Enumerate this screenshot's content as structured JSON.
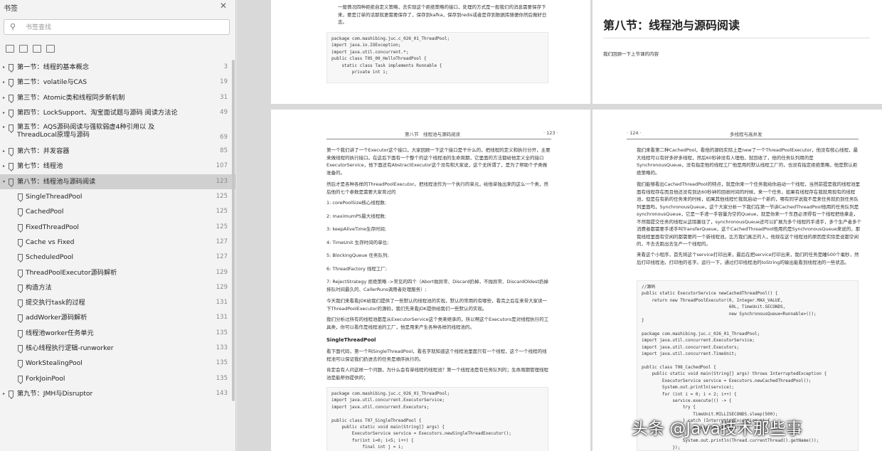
{
  "sidebar": {
    "title": "书签",
    "search_placeholder": "书签查找",
    "items": [
      {
        "label": "第一节：线程的基本概念",
        "page": "3",
        "level": 0,
        "expand": "▸"
      },
      {
        "label": "第二节：volatile与CAS",
        "page": "19",
        "level": 0,
        "expand": "▸"
      },
      {
        "label": "第三节：Atomic类和线程同步新机制",
        "page": "31",
        "level": 0,
        "expand": "▸"
      },
      {
        "label": "第四节：LockSupport、淘宝面试题与源码  阅读方法论",
        "page": "49",
        "level": 0,
        "expand": "▸"
      },
      {
        "label": "第五节：AQS源码阅读与强软弱虚4种引用以  及ThreadLocal原理与源码",
        "page": "69",
        "level": 0,
        "expand": "▸",
        "two": true
      },
      {
        "label": "第六节：并发容器",
        "page": "85",
        "level": 0,
        "expand": "▸"
      },
      {
        "label": "第七节：线程池",
        "page": "107",
        "level": 0,
        "expand": "▸"
      },
      {
        "label": "第八节：线程池与源码阅读",
        "page": "123",
        "level": 0,
        "expand": "▾",
        "selected": true
      },
      {
        "label": "SingleThreadPool",
        "page": "125",
        "level": 1,
        "expand": ""
      },
      {
        "label": "CachedPool",
        "page": "125",
        "level": 1,
        "expand": ""
      },
      {
        "label": "FixedThreadPool",
        "page": "125",
        "level": 1,
        "expand": ""
      },
      {
        "label": "Cache vs Fixed",
        "page": "127",
        "level": 1,
        "expand": ""
      },
      {
        "label": "ScheduledPool",
        "page": "127",
        "level": 1,
        "expand": ""
      },
      {
        "label": "ThreadPoolExecutor源码解析",
        "page": "129",
        "level": 1,
        "expand": ""
      },
      {
        "label": "构造方法",
        "page": "129",
        "level": 1,
        "expand": ""
      },
      {
        "label": "提交执行task的过程",
        "page": "131",
        "level": 1,
        "expand": ""
      },
      {
        "label": "addWorker源码解析",
        "page": "131",
        "level": 1,
        "expand": ""
      },
      {
        "label": "线程池worker任务单元",
        "page": "135",
        "level": 1,
        "expand": ""
      },
      {
        "label": "核心线程执行逻辑-runworker",
        "page": "133",
        "level": 1,
        "expand": ""
      },
      {
        "label": "WorkStealingPool",
        "page": "135",
        "level": 1,
        "expand": ""
      },
      {
        "label": "ForkJoinPool",
        "page": "135",
        "level": 1,
        "expand": ""
      },
      {
        "label": "第九节：JMH与Disruptor",
        "page": "143",
        "level": 0,
        "expand": "▸"
      }
    ]
  },
  "pages": {
    "p1": {
      "intro": "一般情况四种拒绝自定义策略，去实现这个拒绝策略的接口，处理的方式是一般我们的消息需要保存下来，要是订单的话那就更需要保存了，保存到kafka，保存到redis或者是存到数据库随便你然后做好日志。",
      "code": [
        "package com.mashibing.juc.c_026_01_ThreadPool;",
        "import java.io.IOException;",
        "import java.util.concurrent.*;",
        "public class T05_00_HelloThreadPool {",
        "    static class Task implements Runnable {",
        "        private int i;"
      ]
    },
    "p2": {
      "title": "第八节：线程池与源码阅读",
      "intro": "我们回顾一下上节课的内容"
    },
    "p3": {
      "header_title": "第八节　线程池与源码阅读",
      "header_page": "· 123 ·",
      "para1": "第一个我们讲了一个Executor这个接口，大家回顾一下这个接口是干什么的，把线程的定义和执行分开，主要来做线程的执行接口。在这后下面有一个整个的这个线程池的生命周期，它里面的方法都给他定义全的接口ExecutorService，他下面还有AbstractExecutor这个没有和大家说，这个无所谓了，是为了帮助个子类做准备的。",
      "para2": "然后才是各种各样的ThreadPoolExecutor。把线程池作为一个执行的单元，给他单独出来的这么一个类，然后他的七个参数是需要大家背过的",
      "params": [
        "1:  corePoolSize核心线程数;",
        "2:  maximumPS最大线程数;",
        "3:  keepAliveTime生存时间;",
        "4:  TimeUnit 生存时间的单位;",
        "5:  BlockingQueue 任务队列;",
        "6:  ThreadFactory 线程工厂;",
        "7:  RejectStrategy 拒绝策略 ->常见的四个（Abort抛异常、Discard扔掉，不抛异常、DiscardOldest扔掉排队时间最久的、CallerRuns调用者处理服务）;"
      ],
      "para3": "今天我们来看看JDK给我们提供了一些默认的线程池的实现，默认的常用的有哪些，看完之后在来带大家读一下ThreadPoolExecutor的源码，我们先来看JDK提供给我们一些默认的实现。",
      "para4": "我们分析过所有的线程池都是从ExecutorService这个类来继承的，所以啊这个Executors是对线程执行的工具类，你可以看作是线程池的工厂，他是用来产生各种各样的线程池的。",
      "sec": "SingleThreadPool",
      "para5": "看下面代码，第一个叫SingleThreadPool，看名字就知道这个线程池里面只有一个线程，这个一个线程的线程池可以保证我们扔进去的任务是顺序执行的。",
      "para6": "肯定会有人问这样一个问题，为什么会有单线程的线程池？第一个线程池是有任务队列的；生命周期管理线程池是能帮你提供的；",
      "code": [
        "package com.mashibing.juc.c_026_01_ThreadPool;",
        "import java.util.concurrent.ExecutorService;",
        "import java.util.concurrent.Executors;",
        "",
        "public class T07_SingleThreadPool {",
        "    public static void main(String[] args) {",
        "        ExecutorService service = Executors.newSingleThreadExecutor();",
        "        for(int i=0; i<5; i++) {",
        "            final int j = i;"
      ]
    },
    "p4": {
      "header_page": "· 124 ·",
      "header_title": "多线程与高并发",
      "para1": "我们来看第二种CachedPool，看他的源码实际上是new了一个ThreadPoolExecutor，他没有核心线程，最大线程可以有好多好多线程，然后60秒钟没有人理他，就回收了，他的任务队列用的是SynchronousQueue，没有指定他的线程工厂他是用的默认线程工厂的，也没有指定拒绝策略，他是默认拒绝策略的。",
      "para2": "我们能够看出CachedThreadPool的特点，就是你来一个任务我给你启动一个线程，当然前提是我的线程池里面有线程存在而且他还没有到达60秒钟的回收时间的时候，来一个任务，如果有线程存在我就用现有的线程池，但是在有新的任务来的时候，如果其他线程忙我就启动一个新的，哪有同学说我不是来任务就扔到任务队列里面吗，SynchronousQueue，这个大家分析一下我们在第一节讲CachedThreadPool他用的任务队列是synchronousQueue，它是一手递一手容量为空的Queue，就是你来一个东西必须得有一个线程把他拿走，不然我提交任务的线程从这阻塞住了，synchronousQueue还可以扩展为多个线程的手递手，多个生产者多个消费者都需要手递手叫TransferQueue，这个CachedThreadPool他用的是SynchronousQueue来说的，那我线程里面有空闲的都需要的一个新线程池，比方我们真正的人，他现在这个线程池的原因是实际是说都空闲的，不去去跑出去生产一个线程的。",
      "para3": "来看这个小程序，首先将这个service打印出来，最后在把service打印出来，我们的任务是睡500个毫秒，然后打印线程池，打印他的名字。运行一下，通过打印线程池的toString的输出能看到线程池的一些状态。",
      "code": [
        "//源码",
        "public static ExecutorService newCachedThreadPool() {",
        "    return new ThreadPoolExecutor(0, Integer.MAX_VALUE,",
        "                                  60L, TimeUnit.SECONDS,",
        "                                  new SynchronousQueue<Runnable>());",
        "}",
        "",
        "package com.mashibing.juc.c_026_01_ThreadPool;",
        "import java.util.concurrent.ExecutorService;",
        "import java.util.concurrent.Executors;",
        "import java.util.concurrent.TimeUnit;",
        "",
        "public class T08_CachedPool {",
        "    public static void main(String[] args) throws InterruptedException {",
        "        ExecutorService service = Executors.newCachedThreadPool();",
        "        System.out.println(service);",
        "        for (int i = 0; i < 2; i++) {",
        "            service.execute(() -> {",
        "                try {",
        "                    TimeUnit.MILLISECONDS.sleep(500);",
        "                } catch (InterruptedException e) {",
        "                    e.printStackTrace();",
        "                }",
        "                System.out.println(Thread.currentThread().getName());",
        "            });"
      ]
    }
  },
  "watermark": "头条 @Java技术那些事"
}
